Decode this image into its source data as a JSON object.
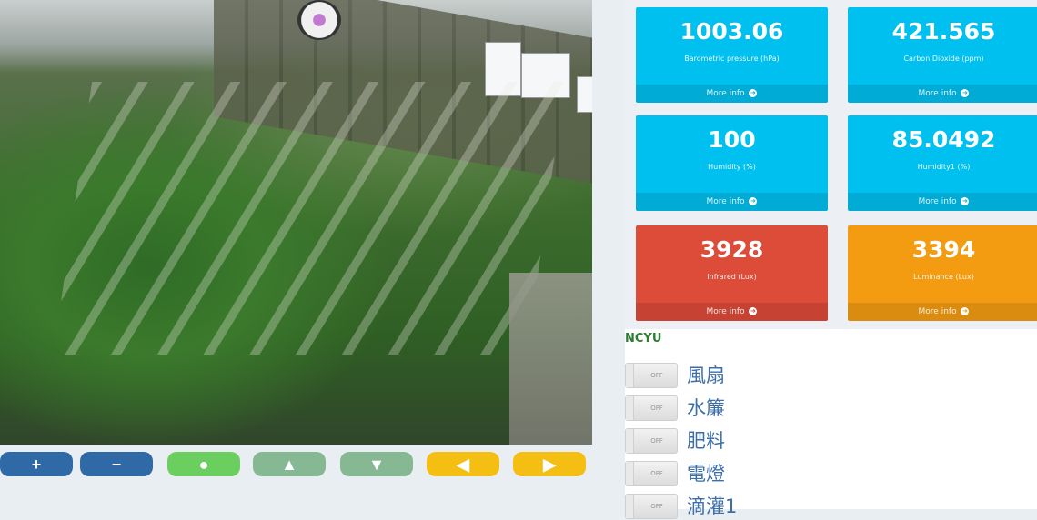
{
  "camera": {
    "description_icon": "greenhouse-camera-feed",
    "controls": [
      {
        "id": "zoom-in",
        "glyph": "+",
        "icon": "plus-icon",
        "color": "#2f6aa6"
      },
      {
        "id": "zoom-out",
        "glyph": "−",
        "icon": "minus-icon",
        "color": "#2f6aa6"
      },
      {
        "id": "home",
        "glyph": "●",
        "icon": "circle-icon",
        "color": "#6bcf60"
      },
      {
        "id": "tilt-up",
        "glyph": "▲",
        "icon": "triangle-up-icon",
        "color": "#86b894"
      },
      {
        "id": "tilt-down",
        "glyph": "▼",
        "icon": "triangle-down-icon",
        "color": "#86b894"
      },
      {
        "id": "pan-left",
        "glyph": "◀",
        "icon": "triangle-left-icon",
        "color": "#f5be12"
      },
      {
        "id": "pan-right",
        "glyph": "▶",
        "icon": "triangle-right-icon",
        "color": "#f5be12"
      }
    ]
  },
  "info_boxes": [
    {
      "value": "1003.06",
      "label": "Barometric pressure (hPa)",
      "more": "More info",
      "color": "#00c0ef"
    },
    {
      "value": "421.565",
      "label": "Carbon Dioxide (ppm)",
      "more": "More info",
      "color": "#00c0ef"
    },
    {
      "value": "100",
      "label": "Humidity (%)",
      "more": "More info",
      "color": "#00c0ef"
    },
    {
      "value": "85.0492",
      "label": "Humidity1 (%)",
      "more": "More info",
      "color": "#00c0ef"
    },
    {
      "value": "3928",
      "label": "Infrared (Lux)",
      "more": "More info",
      "color": "#dd4b39"
    },
    {
      "value": "3394",
      "label": "Luminance (Lux)",
      "more": "More info",
      "color": "#f39c12"
    }
  ],
  "devices": {
    "title": "NCYU",
    "items": [
      {
        "name": "風扇",
        "state": "OFF"
      },
      {
        "name": "水簾",
        "state": "OFF"
      },
      {
        "name": "肥料",
        "state": "OFF"
      },
      {
        "name": "電燈",
        "state": "OFF"
      },
      {
        "name": "滴灌1",
        "state": "OFF"
      }
    ]
  }
}
